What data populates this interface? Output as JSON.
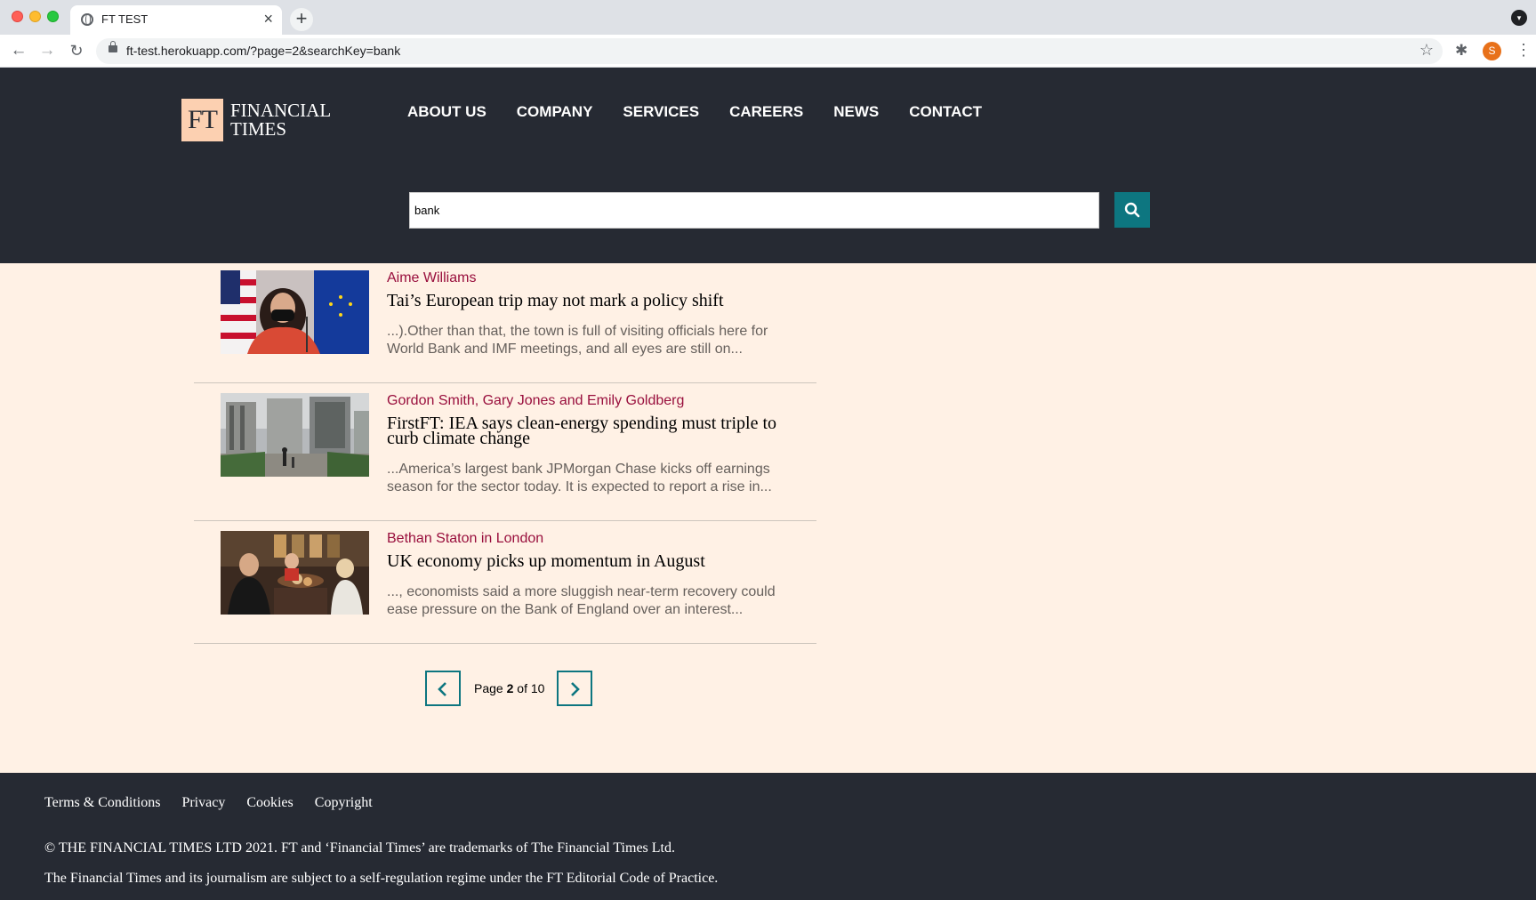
{
  "browser": {
    "tab_title": "FT TEST",
    "tab_close": "×",
    "new_tab": "+",
    "url": "ft-test.herokuapp.com/?page=2&searchKey=bank",
    "profile_initial": "S"
  },
  "header": {
    "logo_mark": "FT",
    "logo_text": "FINANCIAL TIMES",
    "nav": [
      "ABOUT US",
      "COMPANY",
      "SERVICES",
      "CAREERS",
      "NEWS",
      "CONTACT"
    ],
    "search_value": "bank"
  },
  "results": [
    {
      "author": "Aime Williams",
      "title": "Tai’s European trip may not mark a policy shift",
      "snippet": "...).Other than that, the town is full of visiting officials here for World Bank and IMF meetings, and all eyes are still on..."
    },
    {
      "author": "Gordon Smith, Gary Jones and Emily Goldberg",
      "title": "FirstFT: IEA says clean-energy spending must triple to curb climate change",
      "snippet": "...America’s largest bank JPMorgan Chase kicks off earnings season for the sector today. It is expected to report a rise in..."
    },
    {
      "author": "Bethan Staton in London",
      "title": "UK economy picks up momentum in August",
      "snippet": "..., economists said a more sluggish near-term recovery could ease pressure on the Bank of England over an interest..."
    }
  ],
  "pagination": {
    "prefix": "Page",
    "current": "2",
    "middle": "of",
    "total": "10"
  },
  "footer": {
    "links": [
      "Terms & Conditions",
      "Privacy",
      "Cookies",
      "Copyright"
    ],
    "copyright": "© THE FINANCIAL TIMES LTD 2021. FT and ‘Financial Times’ are trademarks of The Financial Times Ltd.",
    "code": "The Financial Times and its journalism are subject to a self-regulation regime under the FT Editorial Code of Practice."
  },
  "colors": {
    "header_bg": "#262a33",
    "page_bg": "#fff1e5",
    "accent_teal": "#0d7680",
    "author_claret": "#990f3d",
    "logo_bg": "#fcd0b1"
  }
}
